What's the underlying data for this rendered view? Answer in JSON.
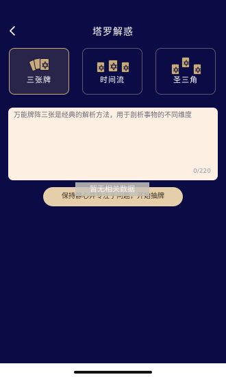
{
  "header": {
    "title": "塔罗解惑",
    "back_icon": "chevron-left-icon"
  },
  "spreads": [
    {
      "label": "三张牌",
      "selected": true
    },
    {
      "label": "时间流",
      "selected": false
    },
    {
      "label": "圣三角",
      "selected": false
    }
  ],
  "question": {
    "text": "万能牌阵三张是经典的解析方法，用于剖析事物的不同维度",
    "counter": "0/220"
  },
  "empty_state": {
    "label": "暂无相关数据"
  },
  "action": {
    "start_label": "保持静心并专注于问题，开始抽牌"
  },
  "colors": {
    "background": "#0b0c45",
    "accent_gold": "#c8a97a",
    "button_bg": "#e5cfab",
    "textbox_bg": "#fdf0e2"
  }
}
